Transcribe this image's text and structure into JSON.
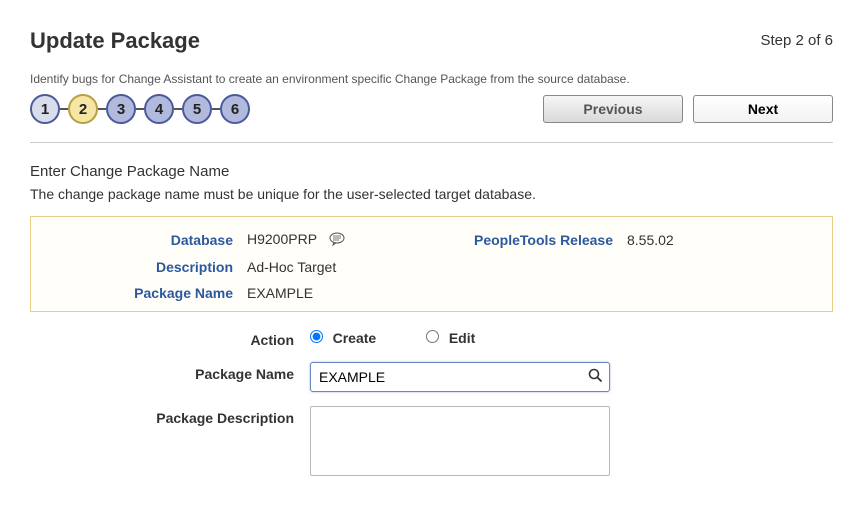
{
  "header": {
    "title": "Update Package",
    "step_text": "Step 2 of 6",
    "subtitle": "Identify bugs for Change Assistant to create an environment specific Change Package from the source database."
  },
  "steps": {
    "items": [
      "1",
      "2",
      "3",
      "4",
      "5",
      "6"
    ],
    "current_index": 1
  },
  "nav": {
    "previous": "Previous",
    "next": "Next"
  },
  "section": {
    "heading": "Enter Change Package Name",
    "desc": "The change package name must be unique for the user-selected target database."
  },
  "info": {
    "database_label": "Database",
    "database_value": "H9200PRP",
    "ptrelease_label": "PeopleTools Release",
    "ptrelease_value": "8.55.02",
    "description_label": "Description",
    "description_value": "Ad-Hoc Target",
    "package_name_label": "Package Name",
    "package_name_value": "EXAMPLE"
  },
  "form": {
    "action_label": "Action",
    "action_create": "Create",
    "action_edit": "Edit",
    "action_selected": "create",
    "package_name_label": "Package Name",
    "package_name_value": "EXAMPLE",
    "package_desc_label": "Package Description",
    "package_desc_value": ""
  }
}
